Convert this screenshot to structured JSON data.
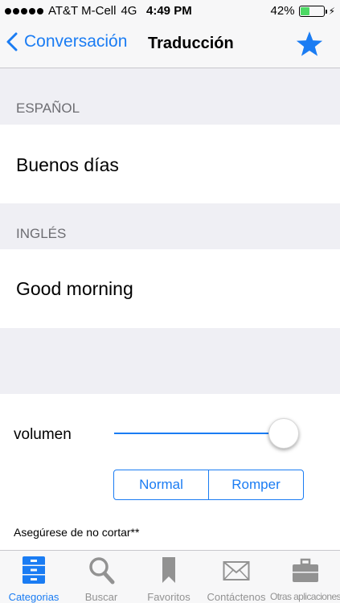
{
  "status": {
    "carrier": "AT&T M-Cell",
    "network": "4G",
    "time": "4:49 PM",
    "battery_text": "42%",
    "battery_level": 0.42
  },
  "nav": {
    "back_label": "Conversación",
    "title": "Traducción",
    "star_icon": "star-icon"
  },
  "spanish": {
    "header": "ESPAÑOL",
    "text": "Buenos días"
  },
  "english": {
    "header": "INGLÉS",
    "text": "Good morning"
  },
  "controls": {
    "volume_label": "volumen",
    "volume_value": 1.0,
    "segments": [
      "Normal",
      "Romper"
    ],
    "note": "Asegúrese de no cortar**"
  },
  "tabs": [
    {
      "label": "Categorias",
      "icon": "categories-icon",
      "active": true
    },
    {
      "label": "Buscar",
      "icon": "search-icon",
      "active": false
    },
    {
      "label": "Favoritos",
      "icon": "bookmark-icon",
      "active": false
    },
    {
      "label": "Contáctenos",
      "icon": "mail-icon",
      "active": false
    },
    {
      "label": "Otras aplicaciones",
      "icon": "briefcase-icon",
      "active": false
    }
  ],
  "colors": {
    "accent": "#1a7cf3",
    "inactive": "#929292",
    "battery": "#4cd964"
  }
}
